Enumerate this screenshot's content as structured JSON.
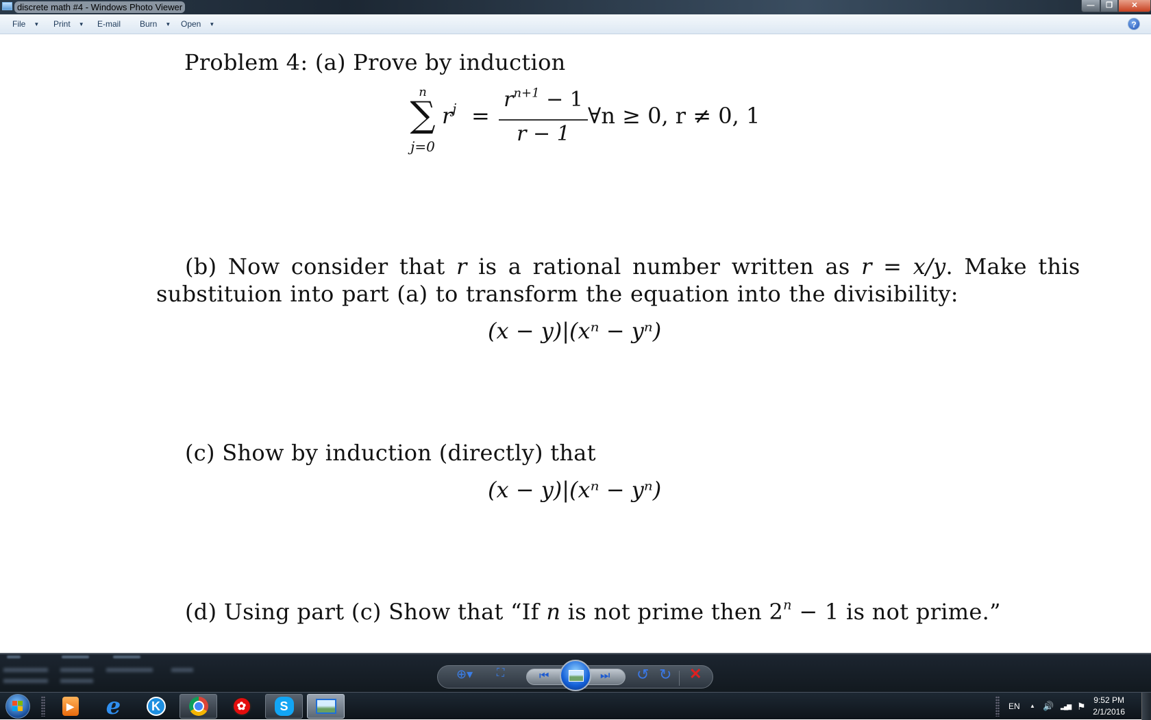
{
  "window": {
    "title": "discrete math #4 - Windows Photo Viewer",
    "controls": {
      "minimize": "—",
      "maximize": "❐",
      "close": "✕"
    }
  },
  "menu": {
    "items": [
      {
        "label": "File",
        "has_dropdown": true
      },
      {
        "label": "Print",
        "has_dropdown": true
      },
      {
        "label": "E-mail",
        "has_dropdown": false
      },
      {
        "label": "Burn",
        "has_dropdown": true
      },
      {
        "label": "Open",
        "has_dropdown": true
      }
    ],
    "caret": "▼",
    "help": "?"
  },
  "document": {
    "heading": "Problem 4:  (a) Prove by induction",
    "formula_a": {
      "sum_upper": "n",
      "sum_symbol": "∑",
      "sum_lower": "j=0",
      "summand_base": "r",
      "summand_exp": "j",
      "equals": "=",
      "numerator_base": "r",
      "numerator_exp": "n+1",
      "numerator_rest": " − 1",
      "denominator": "r − 1",
      "condition": "∀n ≥ 0, r ≠ 0, 1"
    },
    "part_b": {
      "line1_pre": "(b) Now consider that ",
      "line1_var": "r",
      "line1_mid": " is a rational number written as ",
      "line1_eq": "r = x/y",
      "line1_post": ".  Make this",
      "line2": "substituion into part (a) to transform the equation into the divisibility:"
    },
    "formula_b": "(x − y)|(xⁿ − yⁿ)",
    "part_c": "(c) Show by induction (directly) that",
    "formula_c": "(x − y)|(xⁿ − yⁿ)",
    "part_d": {
      "pre": "(d) Using part (c) Show that “If ",
      "var": "n",
      "mid": " is not prime then 2",
      "exp": "n",
      "post": " − 1 is not prime.”"
    }
  },
  "viewer_controls": {
    "zoom": "⊕▾",
    "actual_size": "⛶",
    "previous": "⏮",
    "slideshow": "slideshow",
    "next": "⏭",
    "rotate_ccw": "↺",
    "rotate_cw": "↻",
    "delete": "✕"
  },
  "taskbar": {
    "apps": [
      {
        "name": "Windows Media Player",
        "glyph": "▶"
      },
      {
        "name": "Internet Explorer",
        "glyph": "e"
      },
      {
        "name": "K-Lite",
        "glyph": "K"
      },
      {
        "name": "Google Chrome",
        "glyph": ""
      },
      {
        "name": "Red app",
        "glyph": "✿"
      },
      {
        "name": "Skype",
        "glyph": "S"
      },
      {
        "name": "Windows Photo Viewer",
        "glyph": ""
      }
    ],
    "language": "EN",
    "tray_expand": "▲",
    "volume": "🔊",
    "signal": "▂▄▆",
    "flag": "⚑",
    "time": "9:52 PM",
    "date": "2/1/2016"
  }
}
